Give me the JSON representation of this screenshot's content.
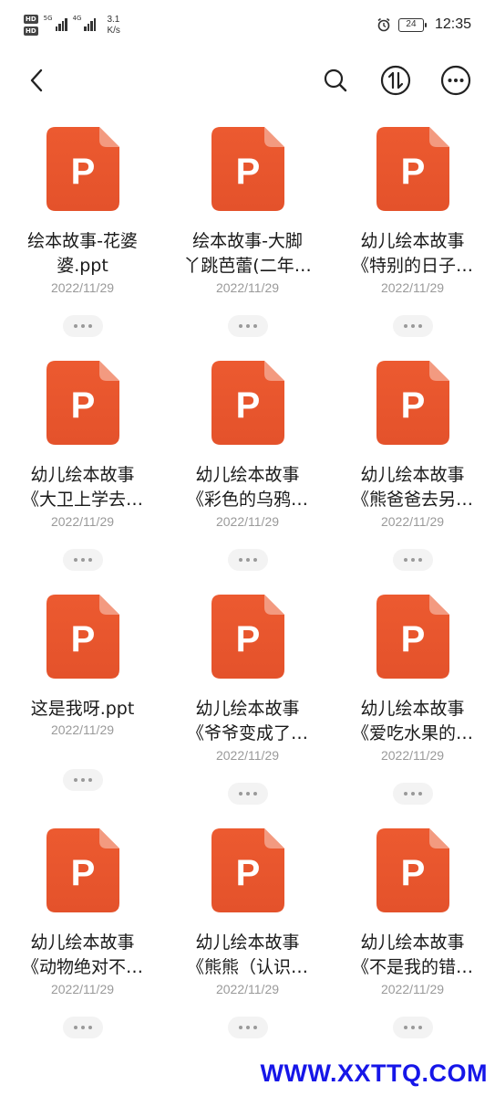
{
  "status_bar": {
    "sim1": "HD",
    "sim2": "HD",
    "signal1": "5G",
    "signal2": "4G",
    "speed_value": "3.1",
    "speed_unit": "K/s",
    "battery": "24",
    "time": "12:35"
  },
  "toolbar": {
    "back_icon": "chevron-left-icon",
    "search_icon": "search-icon",
    "sort_icon": "sort-icon",
    "more_icon": "more-icon"
  },
  "colors": {
    "ppt_orange": "#e4522b",
    "date_gray": "#9a9a9a",
    "watermark_blue": "#1616e8"
  },
  "files": [
    {
      "line1": "绘本故事-花婆",
      "line2": "婆.ppt",
      "date": "2022/11/29"
    },
    {
      "line1": "绘本故事-大脚",
      "line2": "丫跳芭蕾(二年…",
      "date": "2022/11/29"
    },
    {
      "line1": "幼儿绘本故事",
      "line2": "《特别的日子…",
      "date": "2022/11/29"
    },
    {
      "line1": "幼儿绘本故事",
      "line2": "《大卫上学去…",
      "date": "2022/11/29"
    },
    {
      "line1": "幼儿绘本故事",
      "line2": "《彩色的乌鸦…",
      "date": "2022/11/29"
    },
    {
      "line1": "幼儿绘本故事",
      "line2": "《熊爸爸去另…",
      "date": "2022/11/29"
    },
    {
      "line1": "这是我呀.ppt",
      "line2": "",
      "date": "2022/11/29"
    },
    {
      "line1": "幼儿绘本故事",
      "line2": "《爷爷变成了…",
      "date": "2022/11/29"
    },
    {
      "line1": "幼儿绘本故事",
      "line2": "《爱吃水果的…",
      "date": "2022/11/29"
    },
    {
      "line1": "幼儿绘本故事",
      "line2": "《动物绝对不…",
      "date": "2022/11/29"
    },
    {
      "line1": "幼儿绘本故事",
      "line2": "《熊熊（认识…",
      "date": "2022/11/29"
    },
    {
      "line1": "幼儿绘本故事",
      "line2": "《不是我的错…",
      "date": "2022/11/29"
    }
  ],
  "file_icon_letter": "P",
  "watermark": "WWW.XXTTQ.COM"
}
